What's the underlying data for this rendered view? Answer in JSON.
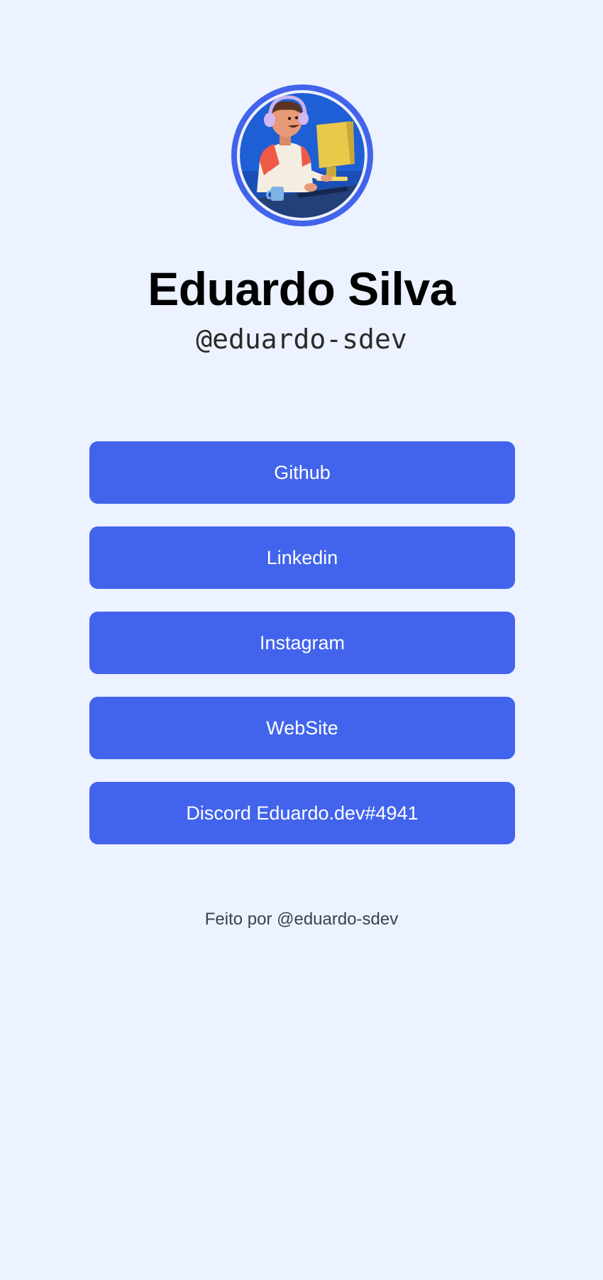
{
  "profile": {
    "name": "Eduardo Silva",
    "handle": "@eduardo-sdev",
    "avatar_icon": "developer-avatar-illustration",
    "ring_color": "#4264ec"
  },
  "links": [
    {
      "label": "Github"
    },
    {
      "label": "Linkedin"
    },
    {
      "label": "Instagram"
    },
    {
      "label": "WebSite"
    },
    {
      "label": "Discord Eduardo.dev#4941"
    }
  ],
  "footer": {
    "text": "Feito por @eduardo-sdev"
  },
  "colors": {
    "background": "#ecf2ff",
    "button": "#4264ec",
    "button_text": "#ffffff"
  }
}
